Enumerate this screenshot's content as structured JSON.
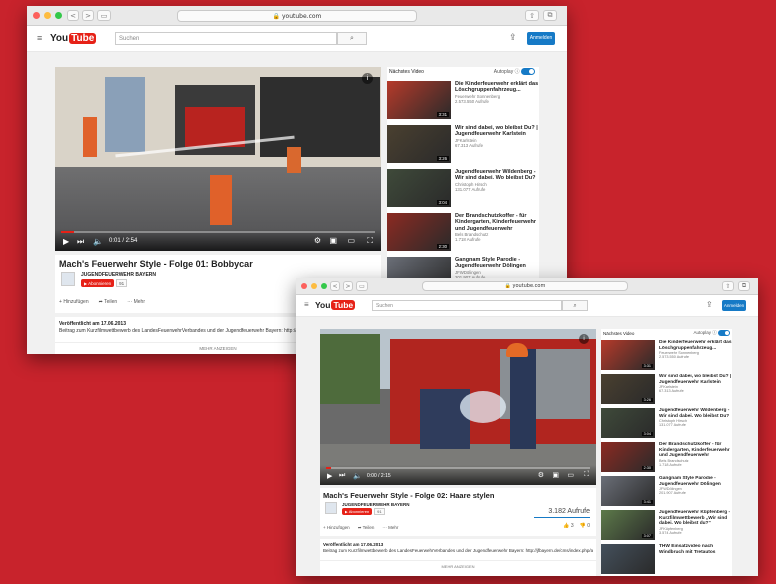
{
  "colors": {
    "background": "#c8232c",
    "yt_red": "#e62117",
    "accent": "#167ac6"
  },
  "browser": {
    "url": "youtube.com"
  },
  "youtube": {
    "logo_you": "You",
    "logo_tube": "Tube",
    "search_placeholder": "Suchen",
    "signin": "Anmelden"
  },
  "front": {
    "video": {
      "title": "Mach's Feuerwehr Style - Folge 02: Haare stylen",
      "channel": "JUGENDFEUERWEHR BAYERN",
      "subscribe": "Abonnieren",
      "sub_count": "91",
      "views": "3.182 Aufrufe",
      "likes": "3",
      "dislikes": "0",
      "time": "0:00 / 2:15"
    },
    "actions": {
      "add": "Hinzufügen",
      "share": "Teilen",
      "more": "Mehr"
    },
    "description": {
      "date": "Veröffentlicht am 17.06.2013",
      "text": "Beitrag zum Kurzfilmwettbewerb des LandesFeuerwehrVerbandes und der Jugendfeuerwehr Bayern: http://jfbayern.de/cms/index.php/akt...",
      "show_more": "MEHR ANZEIGEN"
    },
    "sidebar": {
      "next_label": "Nächstes Video",
      "autoplay_label": "Autoplay",
      "items": [
        {
          "title": "Die Kinderfeuerwehr erklärt das Löschgruppenfahrzeug...",
          "channel": "Feuerwehr Sonnenberg",
          "views": "2.573.550 Aufrufe",
          "duration": "3:31"
        },
        {
          "title": "Wir sind dabei, wo bleibst Du? | Jugendfeuerwehr Karlstein",
          "channel": "JFKarlstein",
          "views": "67.313 Aufrufe",
          "duration": "3:26"
        },
        {
          "title": "Jugendfeuerwehr Wildenberg - Wir sind dabei. Wo bleibst Du?",
          "channel": "Christoph Hirsch",
          "views": "131.077 Aufrufe",
          "duration": "3:04"
        },
        {
          "title": "Der Brandschutzkoffer - für Kindergarten, Kinderfeuerwehr und Jugendfeuerwehr",
          "channel": "Bels Brandschutz",
          "views": "1.718 Aufrufe",
          "duration": "2:30"
        },
        {
          "title": "Gangnam Style Parodie - Jugendfeuerwehr Dölingen",
          "channel": "JFWDölingen",
          "views": "201.907 Aufrufe",
          "duration": "3:41"
        },
        {
          "title": "Jugendfeuerwehr Küpfenberg - Kurzfilmwettbewerb „Wir sind dabei. Wo bleibst du?“",
          "channel": "JFKüpfenberg",
          "views": "3.574 Aufrufe",
          "duration": "3:07"
        },
        {
          "title": "THW Einsatzvideo nach Windbruch mit Tretautos",
          "channel": "",
          "views": "",
          "duration": ""
        }
      ]
    }
  },
  "back": {
    "video": {
      "title": "Mach's Feuerwehr Style - Folge 01: Bobbycar",
      "channel": "JUGENDFEUERWEHR BAYERN",
      "subscribe": "Abonnieren",
      "sub_count": "91",
      "time": "0:01 / 2:54"
    },
    "actions": {
      "add": "Hinzufügen",
      "share": "Teilen",
      "more": "Mehr"
    },
    "description": {
      "date": "Veröffentlicht am 17.06.2013",
      "text": "Beitrag zum Kurzfilmwettbewerb des LandesFeuerwehrVerbandes und der Jugendfeuerwehr Bayern: http://jf...",
      "show_more": "MEHR ANZEIGEN"
    },
    "sidebar": {
      "next_label": "Nächstes Video",
      "autoplay_label": "Autoplay",
      "items": [
        {
          "title": "Die Kinderfeuerwehr erklärt das Löschgruppenfahrzeug...",
          "channel": "Feuerwehr Sonnenberg",
          "views": "2.573.550 Aufrufe",
          "duration": "3:31"
        },
        {
          "title": "Wir sind dabei, wo bleibst Du? | Jugendfeuerwehr Karlstein",
          "channel": "JFKarlstein",
          "views": "67.313 Aufrufe",
          "duration": "3:26"
        },
        {
          "title": "Jugendfeuerwehr Wildenberg - Wir sind dabei. Wo bleibst Du?",
          "channel": "Christoph Hirsch",
          "views": "131.077 Aufrufe",
          "duration": "3:04"
        },
        {
          "title": "Der Brandschutzkoffer - für Kindergarten, Kinderfeuerwehr und Jugendfeuerwehr",
          "channel": "Bels Brandschutz",
          "views": "1.718 Aufrufe",
          "duration": "2:30"
        },
        {
          "title": "Gangnam Style Parodie - Jugendfeuerwehr Dölingen",
          "channel": "JFWDölingen",
          "views": "201.907 Aufrufe",
          "duration": ""
        }
      ]
    }
  }
}
